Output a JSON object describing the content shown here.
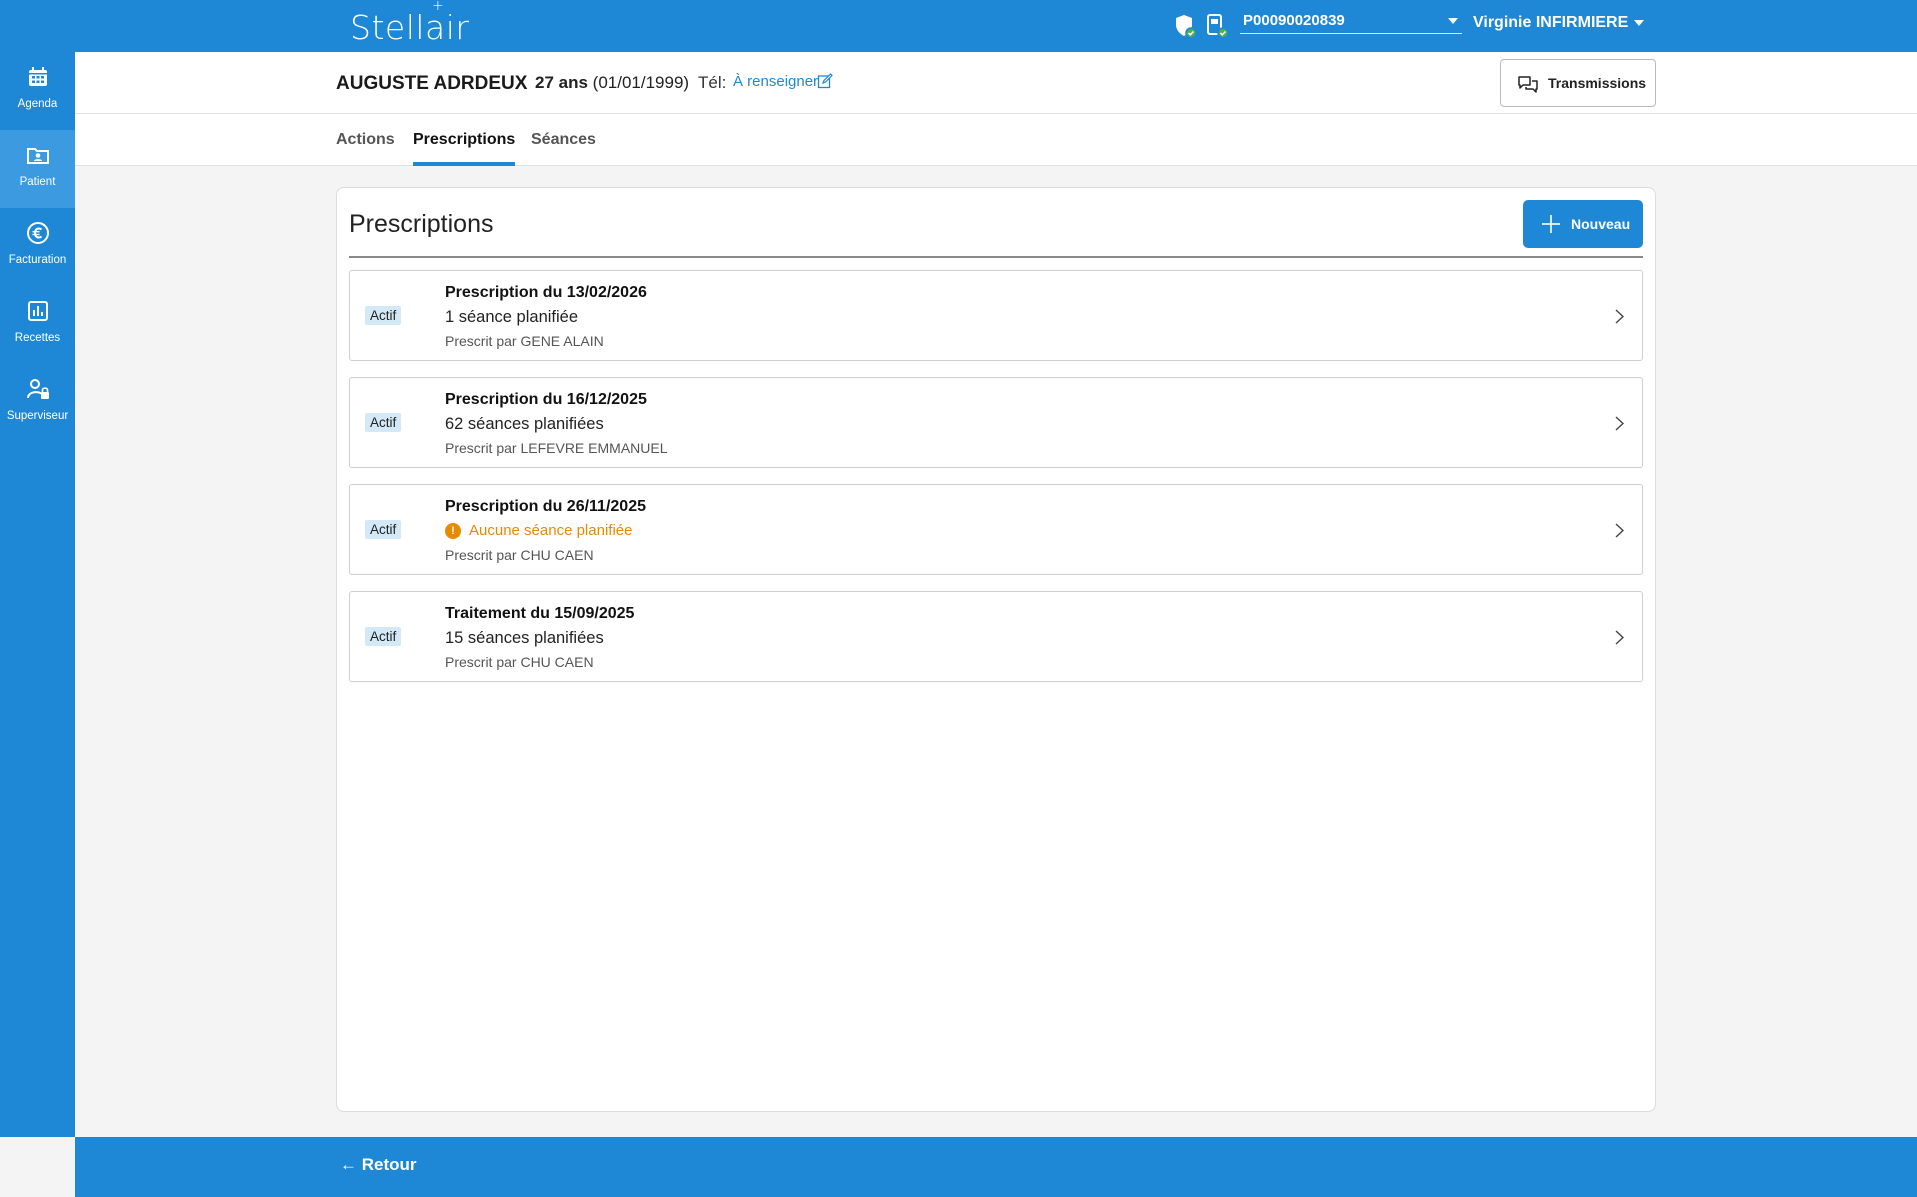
{
  "app": {
    "name": "Stellair"
  },
  "topbar": {
    "device_id": "P00090020839",
    "user_name": "Virginie INFIRMIERE"
  },
  "sidebar": {
    "items": [
      {
        "label": "Agenda",
        "icon": "calendar-icon"
      },
      {
        "label": "Patient",
        "icon": "patient-folder-icon",
        "active": true
      },
      {
        "label": "Facturation",
        "icon": "euro-icon"
      },
      {
        "label": "Recettes",
        "icon": "bar-chart-icon"
      },
      {
        "label": "Superviseur",
        "icon": "user-lock-icon"
      }
    ]
  },
  "patient": {
    "name": "AUGUSTE ADRDEUX",
    "age": "27 ans",
    "birthdate": "(01/01/1999)",
    "tel_label": "Tél:",
    "tel_value": "À renseigner"
  },
  "header": {
    "transmissions_label": "Transmissions"
  },
  "tabs": [
    {
      "label": "Actions"
    },
    {
      "label": "Prescriptions",
      "active": true
    },
    {
      "label": "Séances"
    }
  ],
  "main": {
    "title": "Prescriptions",
    "new_label": "Nouveau",
    "prescriptions": [
      {
        "status": "Actif",
        "title": "Prescription du 13/02/2026",
        "sessions": "1 séance planifiée",
        "prescriber": "Prescrit par GENE ALAIN"
      },
      {
        "status": "Actif",
        "title": "Prescription du 16/12/2025",
        "sessions": "62 séances planifiées",
        "prescriber": "Prescrit par LEFEVRE EMMANUEL"
      },
      {
        "status": "Actif",
        "title": "Prescription du 26/11/2025",
        "warning": "Aucune séance planifiée",
        "prescriber": "Prescrit par CHU CAEN"
      },
      {
        "status": "Actif",
        "title": "Traitement du 15/09/2025",
        "sessions": "15 séances planifiées",
        "prescriber": "Prescrit par CHU CAEN"
      }
    ]
  },
  "footer": {
    "back_label": "Retour"
  },
  "colors": {
    "primary": "#1e88d6",
    "warning": "#e88a00",
    "badge_bg": "#d4e9f7"
  }
}
